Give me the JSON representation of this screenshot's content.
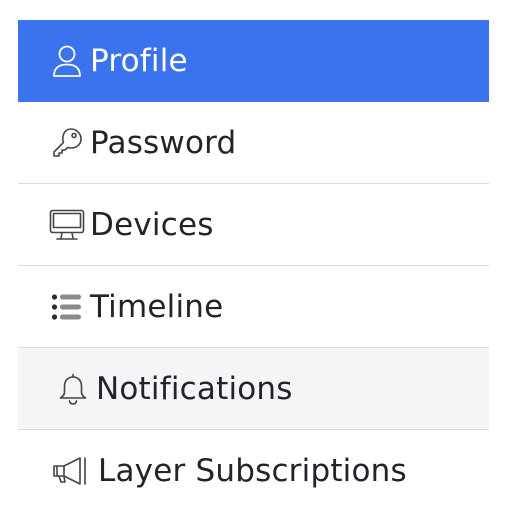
{
  "menu": {
    "items": [
      {
        "label": "Profile",
        "icon": "person-icon",
        "state": "active"
      },
      {
        "label": "Password",
        "icon": "key-icon",
        "state": "normal"
      },
      {
        "label": "Devices",
        "icon": "monitor-icon",
        "state": "normal"
      },
      {
        "label": "Timeline",
        "icon": "list-icon",
        "state": "normal"
      },
      {
        "label": "Notifications",
        "icon": "bell-icon",
        "state": "hover"
      },
      {
        "label": "Layer Subscriptions",
        "icon": "megaphone-icon",
        "state": "normal"
      }
    ],
    "colors": {
      "active_bg": "#3b72ee",
      "active_text": "#ffffff",
      "text": "#212529",
      "divider": "#dcdcdc",
      "hover_bg": "#f4f5f7"
    }
  }
}
